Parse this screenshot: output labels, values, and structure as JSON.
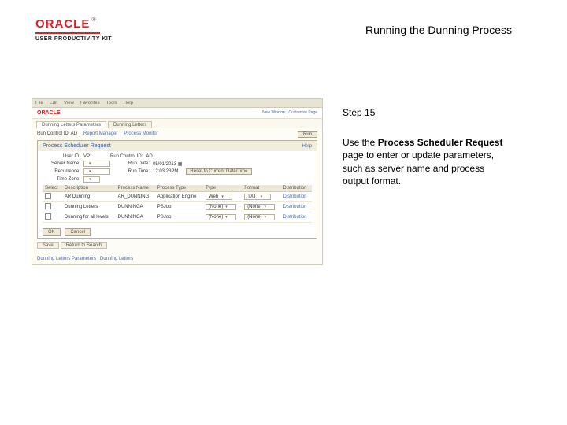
{
  "brand": {
    "logo_text": "ORACLE",
    "tm": "®",
    "tagline": "USER PRODUCTIVITY KIT"
  },
  "page_title": "Running the Dunning Process",
  "step": {
    "label": "Step 15"
  },
  "instruction": {
    "prefix": "Use the ",
    "bold": "Process Scheduler Request",
    "suffix": " page to enter or update parameters, such as server name and process output format."
  },
  "shot": {
    "browser_menu": [
      "File",
      "Edit",
      "View",
      "Favorites",
      "Tools",
      "Help"
    ],
    "oracle": "ORACLE",
    "header_links": "New Window  |  Customize Page",
    "tabs": {
      "active": "Dunning Letters Parameters",
      "inactive": "Dunning Letters"
    },
    "toprow": {
      "run_control": "Run Control ID: AD",
      "report_manager": "Report Manager",
      "process_monitor": "Process Monitor",
      "run_btn": "Run"
    },
    "modal": {
      "title": "Process Scheduler Request",
      "help": "Help",
      "user_id_label": "User ID:",
      "user_id_value": "VP1",
      "run_control_label": "Run Control ID:",
      "run_control_value": "AD",
      "server_name_label": "Server Name:",
      "server_name_value": "",
      "run_date_label": "Run Date:",
      "run_date_value": "05/01/2013 ▦",
      "recurrence_label": "Recurrence:",
      "recurrence_value": "",
      "run_time_label": "Run Time:",
      "run_time_value": "12:03:23PM",
      "reset_btn": "Reset to Current Date/Time",
      "time_zone_label": "Time Zone:",
      "time_zone_value": "",
      "table": {
        "headers": [
          "Select",
          "Description",
          "Process Name",
          "Process Type",
          "Type",
          "Format",
          "Distribution"
        ],
        "rows": [
          {
            "desc": "AR Dunning",
            "name": "AR_DUNNING",
            "ptype": "Application Engine",
            "type": "Web",
            "format": "TXT",
            "dist": "Distribution"
          },
          {
            "desc": "Dunning Letters",
            "name": "DUNNINGA",
            "ptype": "PSJob",
            "type": "(None)",
            "format": "(None)",
            "dist": "Distribution"
          },
          {
            "desc": "Dunning for all levels",
            "name": "DUNNINGA",
            "ptype": "PSJob",
            "type": "(None)",
            "format": "(None)",
            "dist": "Distribution"
          }
        ]
      },
      "ok": "OK",
      "cancel": "Cancel"
    },
    "bottom_tabs": [
      "Save",
      "Return to Search"
    ],
    "trailer": "Dunning Letters Parameters | Dunning Letters"
  }
}
